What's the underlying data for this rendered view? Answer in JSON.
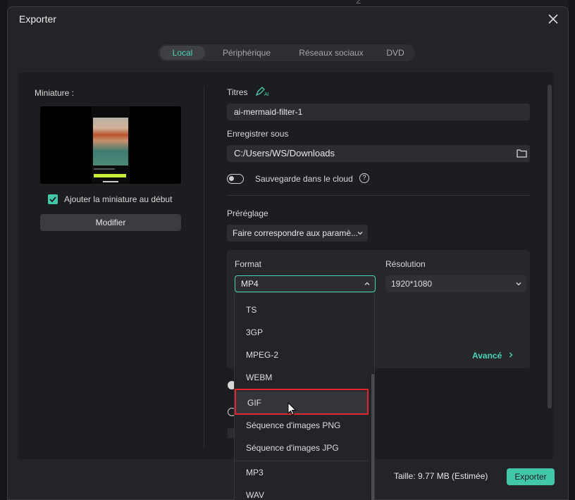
{
  "background": {
    "top_number": "2"
  },
  "dialog": {
    "title": "Exporter",
    "tabs": [
      {
        "label": "Local",
        "active": true
      },
      {
        "label": "Périphérique",
        "active": false
      },
      {
        "label": "Réseaux sociaux",
        "active": false
      },
      {
        "label": "DVD",
        "active": false
      }
    ]
  },
  "thumbnail": {
    "label": "Miniature :",
    "add_at_start_label": "Ajouter la miniature au début",
    "add_at_start_checked": true,
    "modify_button": "Modifier"
  },
  "settings": {
    "title_label": "Titres",
    "title_value": "ai-mermaid-filter-1",
    "save_as_label": "Enregistrer sous",
    "save_as_value": "C:/Users/WS/Downloads",
    "cloud_label": "Sauvegarde dans le cloud",
    "cloud_enabled": false,
    "preset_label": "Préréglage",
    "preset_value": "Faire correspondre aux paramè...",
    "format_label": "Format",
    "format_value": "MP4",
    "resolution_label": "Résolution",
    "resolution_value": "1920*1080",
    "advanced_label": "Avancé"
  },
  "format_dropdown": {
    "items": [
      "TS",
      "3GP",
      "MPEG-2",
      "WEBM",
      "GIF",
      "Séquence d'images PNG",
      "Séquence d'images JPG",
      "MP3",
      "WAV"
    ],
    "hovered_item": "GIF"
  },
  "footer": {
    "size_text": "Taille: 9.77 MB (Estimée)",
    "export_button": "Exporter"
  },
  "colors": {
    "accent": "#42c7a8",
    "accent_text": "#4ad0b4",
    "highlight_box": "#e0262c"
  }
}
